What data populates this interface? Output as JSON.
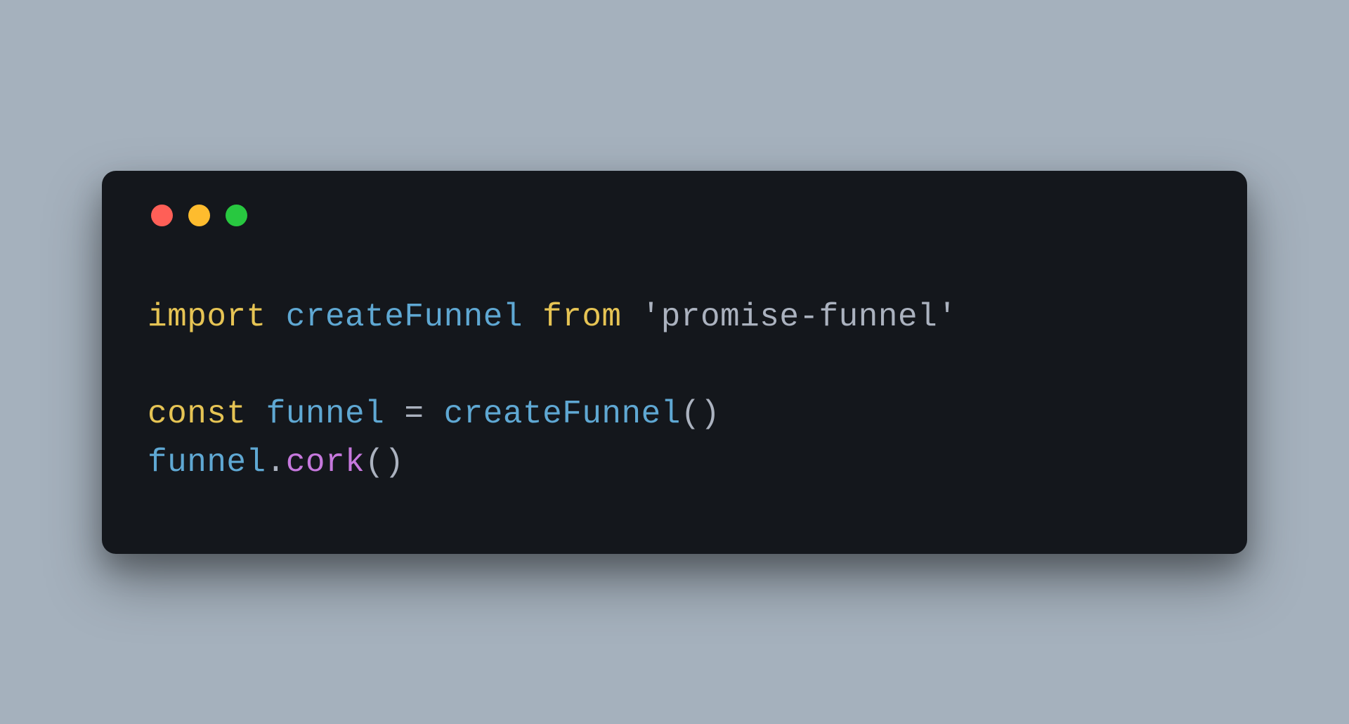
{
  "code": {
    "line1": {
      "t1": "import",
      "t2": " createFunnel ",
      "t3": "from",
      "t4": " 'promise-funnel'"
    },
    "line2": "",
    "line3": {
      "t1": "const",
      "t2": " funnel ",
      "t3": "=",
      "t4": " createFunnel",
      "t5": "()"
    },
    "line4": {
      "t1": "funnel",
      "t2": ".",
      "t3": "cork",
      "t4": "()"
    }
  }
}
